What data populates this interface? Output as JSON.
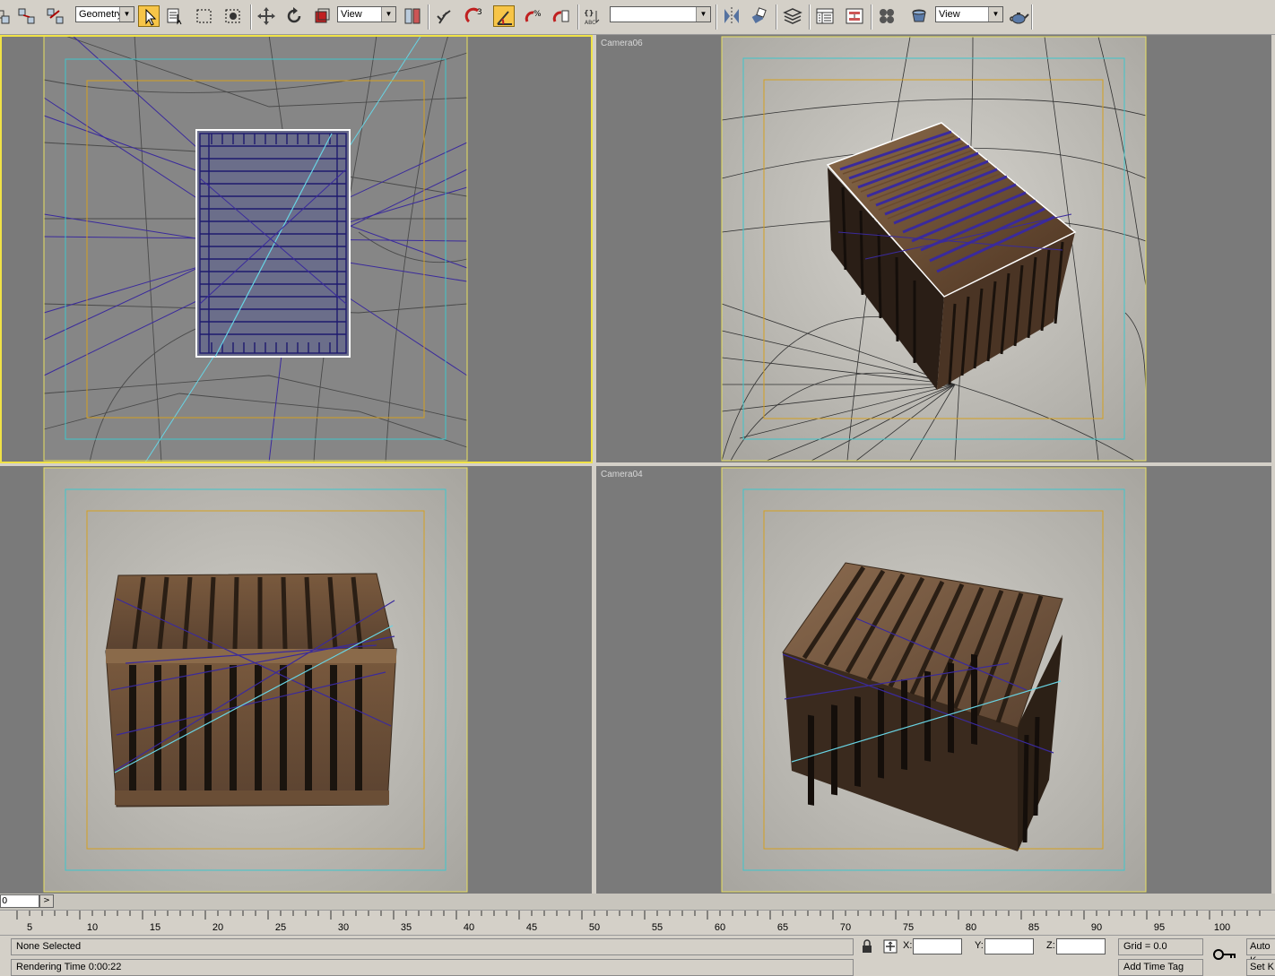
{
  "toolbar": {
    "selection_filter": "Geometry",
    "ref_coord_system": "View",
    "named_selection": "",
    "render_preset": "View",
    "buttons": [
      "undo-icon",
      "select-link-icon",
      "unlink-icon",
      "select-object-icon",
      "select-by-name-icon",
      "rectangular-selection-icon",
      "window-crossing-icon",
      "move-icon",
      "rotate-icon",
      "scale-icon",
      "mirror-icon",
      "align-icon",
      "snaps-toggle-icon",
      "angle-snap-icon",
      "percent-snap-icon",
      "spinner-snap-icon",
      "edit-named-selection-icon",
      "layer-manager-icon",
      "curve-editor-icon",
      "schematic-view-icon",
      "material-editor-icon",
      "render-setup-icon",
      "render-teapot-icon"
    ],
    "active_button": "angle-snap-icon"
  },
  "viewports": {
    "top_left": {
      "label": ""
    },
    "top_right": {
      "label": "Camera06"
    },
    "bottom_left": {
      "label": ""
    },
    "bottom_right": {
      "label": "Camera04"
    }
  },
  "timeslider": {
    "frame_value": "0",
    "next_label": ">"
  },
  "trackbar": {
    "ticks": [
      "5",
      "10",
      "15",
      "20",
      "25",
      "30",
      "35",
      "40",
      "45",
      "50",
      "55",
      "60",
      "65",
      "70",
      "75",
      "80",
      "85",
      "90",
      "95",
      "100"
    ]
  },
  "status": {
    "selection": "None Selected",
    "prompt": "Rendering Time 0:00:22",
    "x_label": "X:",
    "y_label": "Y:",
    "z_label": "Z:",
    "grid": "Grid = 0.0",
    "auto_key": "Auto K",
    "set_key": "Set K",
    "add_time_tag": "Add Time Tag"
  }
}
